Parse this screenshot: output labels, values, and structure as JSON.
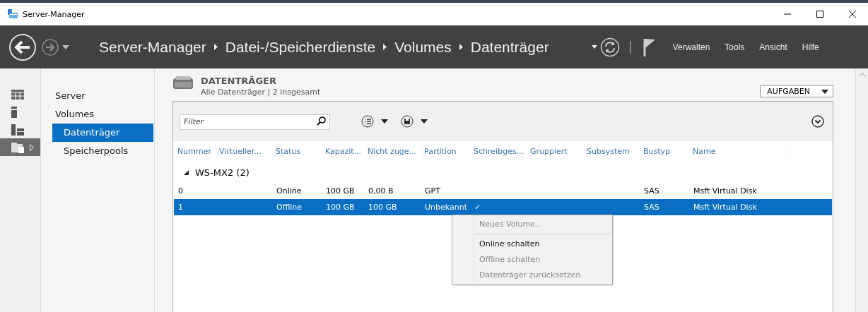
{
  "window": {
    "title": "Server-Manager"
  },
  "header": {
    "breadcrumb": [
      "Server-Manager",
      "Datei-/Speicherdienste",
      "Volumes",
      "Datenträger"
    ],
    "menu": [
      "Verwalten",
      "Tools",
      "Ansicht",
      "Hilfe"
    ]
  },
  "rail": [
    {
      "kind": "dashboard",
      "selected": false
    },
    {
      "kind": "server",
      "selected": false
    },
    {
      "kind": "servers",
      "selected": false
    },
    {
      "kind": "files",
      "selected": true
    }
  ],
  "nav": [
    {
      "label": "Server",
      "selected": false
    },
    {
      "label": "Volumes",
      "selected": false,
      "children": [
        {
          "label": "Datenträger",
          "selected": true
        },
        {
          "label": "Speicherpools",
          "selected": false
        }
      ]
    }
  ],
  "panel": {
    "title": "DATENTRÄGER",
    "subtitle": "Alle Datenträger | 2 insgesamt",
    "tasks": "AUFGABEN",
    "filter": {
      "placeholder": "Filter"
    },
    "columns": [
      "Nummer",
      "Virtueller...",
      "Status",
      "Kapazit...",
      "Nicht zuge...",
      "Partition",
      "Schreibges...",
      "Gruppiert",
      "Subsystem",
      "Bustyp",
      "Name"
    ],
    "groups": [
      {
        "label": "WS-MX2 (2)",
        "expanded": true,
        "rows": [
          {
            "selected": false,
            "cells": [
              "0",
              "",
              "Online",
              "100 GB",
              "0,00 B",
              "GPT",
              "",
              "",
              "",
              "SAS",
              "Msft Virtual Disk"
            ]
          },
          {
            "selected": true,
            "cells": [
              "1",
              "",
              "Offline",
              "100 GB",
              "100 GB",
              "Unbekannt",
              "✓",
              "",
              "",
              "SAS",
              "Msft Virtual Disk"
            ]
          }
        ]
      }
    ]
  },
  "context_menu": [
    {
      "kind": "item",
      "label": "Neues Volume...",
      "disabled": true
    },
    {
      "kind": "separator"
    },
    {
      "kind": "item",
      "label": "Online schalten",
      "disabled": false
    },
    {
      "kind": "item",
      "label": "Offline schalten",
      "disabled": true
    },
    {
      "kind": "item",
      "label": "Datenträger zurücksetzen",
      "disabled": true
    }
  ]
}
